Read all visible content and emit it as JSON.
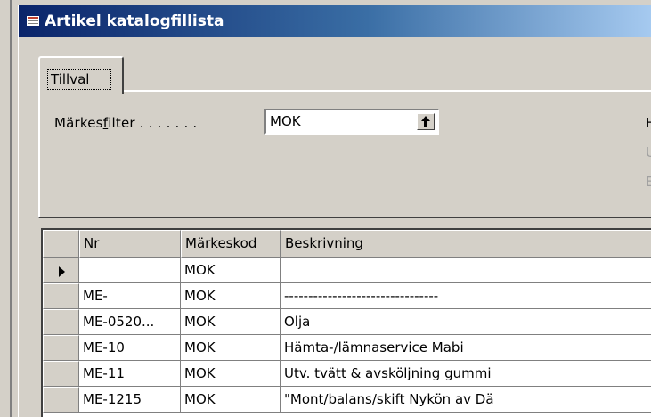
{
  "window": {
    "title": "Artikel katalogfillista"
  },
  "tabs": [
    {
      "label": "Tillval"
    }
  ],
  "filter": {
    "label_pre": "Märkes",
    "label_underlined": "f",
    "label_post": "ilter . . . . . . .",
    "value": "MOK"
  },
  "side_chars": [
    "H",
    "U",
    "E"
  ],
  "table": {
    "columns": [
      "",
      "Nr",
      "Märkeskod",
      "Beskrivning"
    ],
    "rows": [
      {
        "nr": "",
        "code": "MOK",
        "desc": ""
      },
      {
        "nr": "ME-",
        "code": "MOK",
        "desc": "--------------------------------"
      },
      {
        "nr": "ME-0520...",
        "code": "MOK",
        "desc": "Olja"
      },
      {
        "nr": "ME-10",
        "code": "MOK",
        "desc": "Hämta-/lämnaservice Mabi"
      },
      {
        "nr": "ME-11",
        "code": "MOK",
        "desc": "Utv. tvätt & avsköljning gummi"
      },
      {
        "nr": "ME-1215",
        "code": "MOK",
        "desc": "\"Mont/balans/skift Nykön av Dä"
      }
    ]
  }
}
